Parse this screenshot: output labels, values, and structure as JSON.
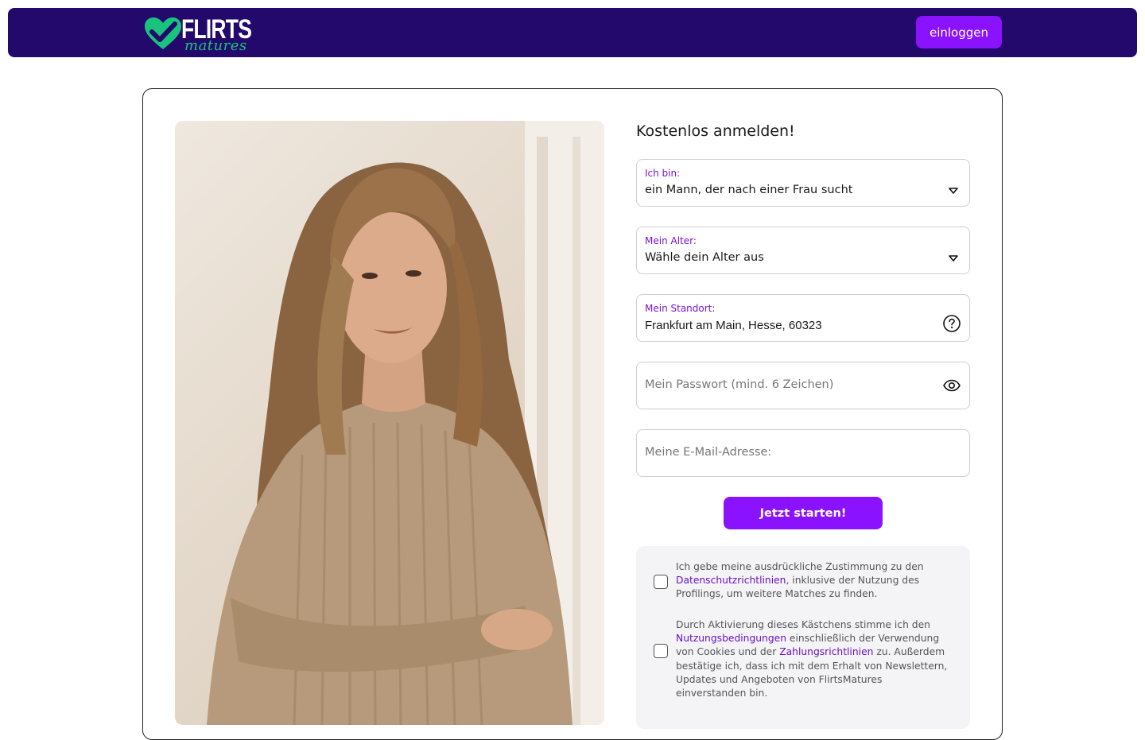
{
  "header": {
    "logo_main": "FLIRTS",
    "logo_sub": "matures",
    "login_label": "einloggen"
  },
  "colors": {
    "header_bg": "#23096b",
    "accent": "#8a12ff",
    "label_purple": "#7a12d8",
    "logo_green": "#19c37d"
  },
  "form": {
    "title": "Kostenlos anmelden!",
    "gender": {
      "label": "Ich bin:",
      "value": "ein Mann, der nach einer Frau sucht",
      "icon": "chevron-down-icon"
    },
    "age": {
      "label": "Mein Alter:",
      "value": "Wähle dein Alter aus",
      "icon": "chevron-down-icon"
    },
    "location": {
      "label": "Mein Standort:",
      "value": "Frankfurt am Main, Hesse, 60323",
      "icon": "help-icon"
    },
    "password": {
      "placeholder": "Mein Passwort (mind. 6 Zeichen)",
      "icon": "eye-icon"
    },
    "email": {
      "placeholder": "Meine E-Mail-Adresse:"
    },
    "submit_label": "Jetzt starten!"
  },
  "consents": [
    {
      "text_before": "Ich gebe meine ausdrückliche Zustimmung zu den ",
      "link1": "Datenschutzrichtlinien",
      "text_after": ", inklusive der Nutzung des Profilings, um weitere Matches zu finden."
    },
    {
      "text_before": "Durch Aktivierung dieses Kästchens stimme ich den ",
      "link1": "Nutzungsbedingungen",
      "text_middle": " einschließlich der Verwendung von Cookies und der ",
      "link2": "Zahlungsrichtlinien",
      "text_after": " zu. Außerdem bestätige ich, dass ich mit dem Erhalt von Newslettern, Updates und Angeboten von FlirtsMatures einverstanden bin."
    }
  ]
}
